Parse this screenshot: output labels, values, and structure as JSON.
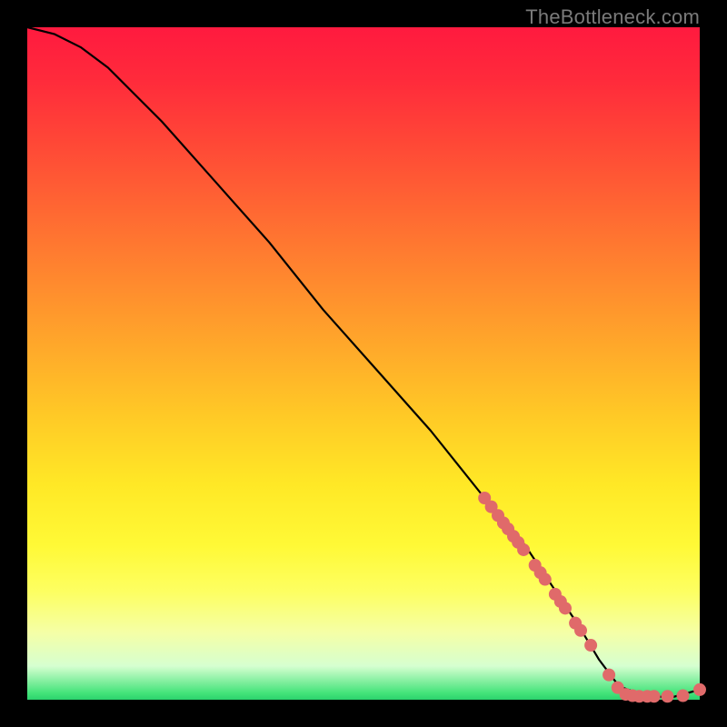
{
  "watermark": "TheBottleneck.com",
  "chart_data": {
    "type": "line",
    "title": "",
    "xlabel": "",
    "ylabel": "",
    "xlim": [
      0,
      100
    ],
    "ylim": [
      0,
      100
    ],
    "grid": false,
    "legend": false,
    "gradient_meaning": "background color indicates bottleneck severity: red=high, yellow=mid, green=optimal",
    "series": [
      {
        "name": "bottleneck-curve",
        "color": "#000000",
        "x": [
          0,
          4,
          8,
          12,
          16,
          20,
          28,
          36,
          44,
          52,
          60,
          68,
          74,
          78,
          82,
          85,
          88,
          92,
          96,
          100
        ],
        "y": [
          100,
          99,
          97,
          94,
          90,
          86,
          77,
          68,
          58,
          49,
          40,
          30,
          23,
          17,
          11,
          6,
          2,
          0.5,
          0.4,
          1.5
        ]
      }
    ],
    "markers": [
      {
        "name": "sample-points",
        "color": "#e06a6a",
        "radius": 7,
        "points": [
          {
            "x": 68.0,
            "y": 30.0
          },
          {
            "x": 69.0,
            "y": 28.7
          },
          {
            "x": 70.0,
            "y": 27.4
          },
          {
            "x": 70.8,
            "y": 26.3
          },
          {
            "x": 71.5,
            "y": 25.4
          },
          {
            "x": 72.3,
            "y": 24.3
          },
          {
            "x": 73.0,
            "y": 23.4
          },
          {
            "x": 73.8,
            "y": 22.3
          },
          {
            "x": 75.5,
            "y": 20.0
          },
          {
            "x": 76.3,
            "y": 18.9
          },
          {
            "x": 77.0,
            "y": 17.9
          },
          {
            "x": 78.5,
            "y": 15.7
          },
          {
            "x": 79.3,
            "y": 14.6
          },
          {
            "x": 80.0,
            "y": 13.6
          },
          {
            "x": 81.5,
            "y": 11.4
          },
          {
            "x": 82.3,
            "y": 10.3
          },
          {
            "x": 83.8,
            "y": 8.1
          },
          {
            "x": 86.5,
            "y": 3.7
          },
          {
            "x": 87.8,
            "y": 1.8
          },
          {
            "x": 89.0,
            "y": 0.8
          },
          {
            "x": 90.0,
            "y": 0.6
          },
          {
            "x": 91.0,
            "y": 0.5
          },
          {
            "x": 92.2,
            "y": 0.5
          },
          {
            "x": 93.2,
            "y": 0.5
          },
          {
            "x": 95.2,
            "y": 0.5
          },
          {
            "x": 97.5,
            "y": 0.6
          },
          {
            "x": 100.0,
            "y": 1.5
          }
        ]
      }
    ]
  }
}
